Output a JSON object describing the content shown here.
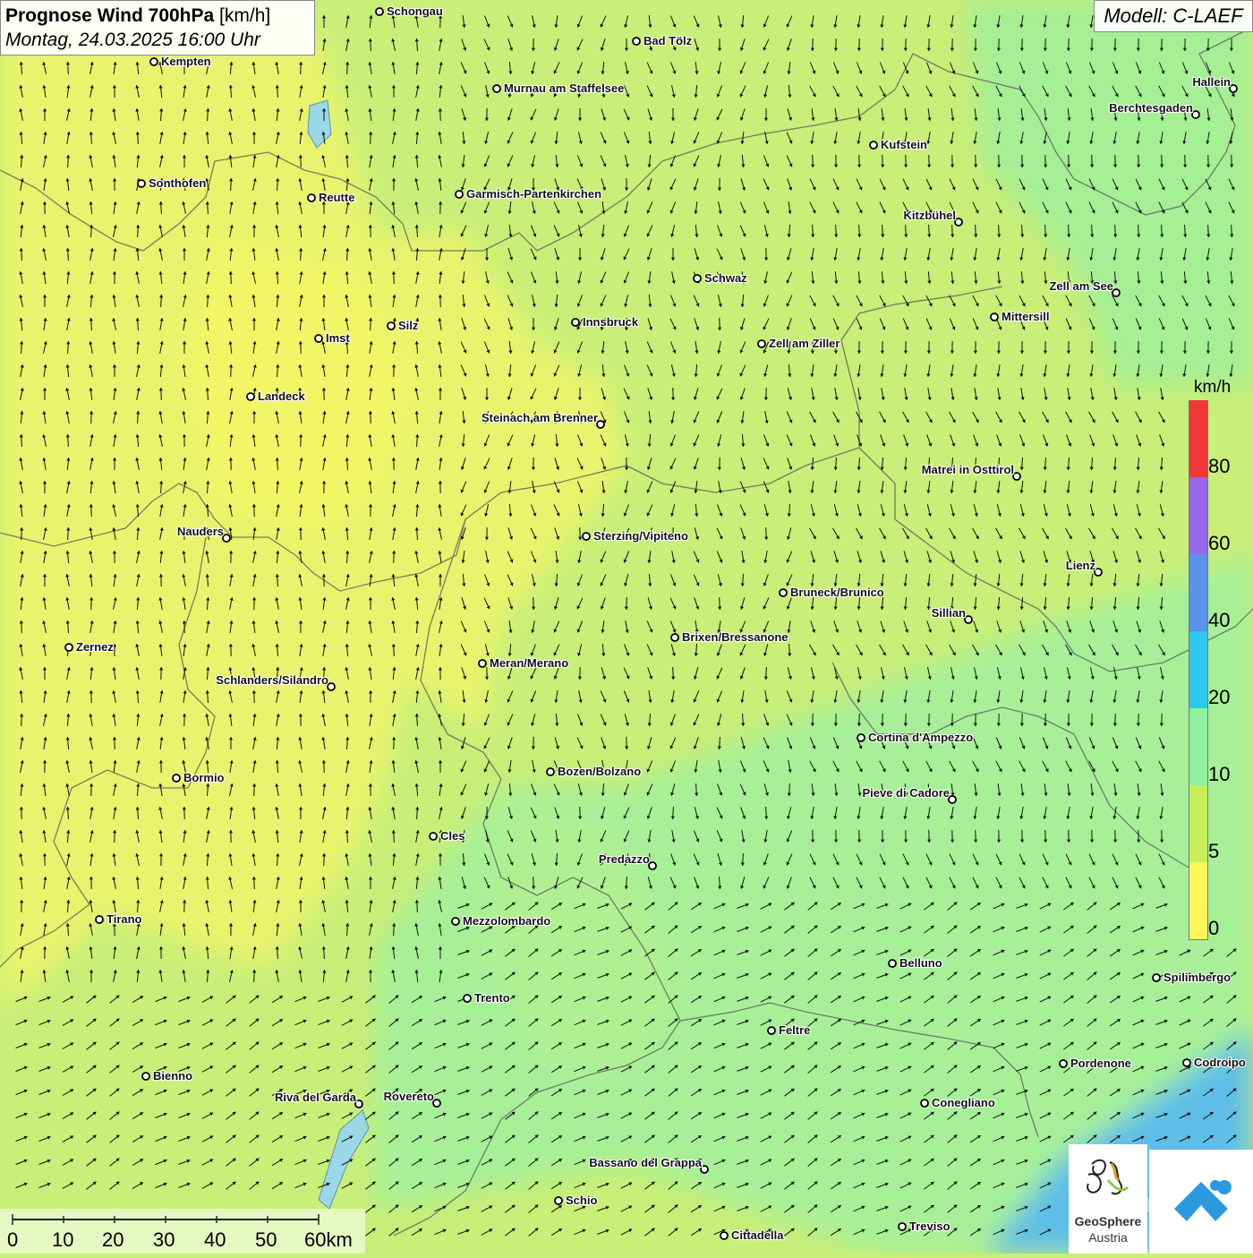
{
  "header": {
    "title_bold": "Prognose Wind 700hPa",
    "title_unit": "[km/h]",
    "datetime": "Montag, 24.03.2025 16:00 Uhr",
    "model": "Modell: C-LAEF"
  },
  "legend": {
    "unit": "km/h",
    "classes": [
      {
        "label": "0",
        "color": "#fff65a"
      },
      {
        "label": "5",
        "color": "#c8ef5a"
      },
      {
        "label": "10",
        "color": "#8ff0a0"
      },
      {
        "label": "20",
        "color": "#2fc6f0"
      },
      {
        "label": "40",
        "color": "#5a92ea"
      },
      {
        "label": "60",
        "color": "#9966ee"
      },
      {
        "label": "80",
        "color": "#f23838"
      }
    ]
  },
  "scale_bar": {
    "labels": [
      "0",
      "10",
      "20",
      "30",
      "40",
      "50",
      "60km"
    ]
  },
  "logo": {
    "name_line1": "GeoSphere",
    "name_line2": "Austria"
  },
  "cities": [
    {
      "name": "Schongau"
    },
    {
      "name": "Bad Tölz"
    },
    {
      "name": "Kempten"
    },
    {
      "name": "Murnau am Staffelsee"
    },
    {
      "name": "Hallein"
    },
    {
      "name": "Berchtesgaden"
    },
    {
      "name": "Kufstein"
    },
    {
      "name": "Sonthofen"
    },
    {
      "name": "Reutte"
    },
    {
      "name": "Garmisch-Partenkirchen"
    },
    {
      "name": "Kitzbühel"
    },
    {
      "name": "Schwaz"
    },
    {
      "name": "Zell am See"
    },
    {
      "name": "Mittersill"
    },
    {
      "name": "Innsbruck"
    },
    {
      "name": "Silz"
    },
    {
      "name": "Imst"
    },
    {
      "name": "Zell am Ziller"
    },
    {
      "name": "Landeck"
    },
    {
      "name": "Steinach am Brenner"
    },
    {
      "name": "Matrei in Osttirol"
    },
    {
      "name": "Nauders"
    },
    {
      "name": "Sterzing/Vipiteno"
    },
    {
      "name": "Lienz"
    },
    {
      "name": "Bruneck/Brunico"
    },
    {
      "name": "Sillian"
    },
    {
      "name": "Brixen/Bressanone"
    },
    {
      "name": "Zernez"
    },
    {
      "name": "Meran/Merano"
    },
    {
      "name": "Schlanders/Silandro"
    },
    {
      "name": "Cortina d'Ampezzo"
    },
    {
      "name": "Bozen/Bolzano"
    },
    {
      "name": "Bormio"
    },
    {
      "name": "Pieve di Cadore"
    },
    {
      "name": "Cles"
    },
    {
      "name": "Predazzo"
    },
    {
      "name": "Tirano"
    },
    {
      "name": "Mezzolombardo"
    },
    {
      "name": "Belluno"
    },
    {
      "name": "Spilimbergo"
    },
    {
      "name": "Trento"
    },
    {
      "name": "Feltre"
    },
    {
      "name": "Pordenone"
    },
    {
      "name": "Codroipo"
    },
    {
      "name": "Bienno"
    },
    {
      "name": "Riva del Garda"
    },
    {
      "name": "Rovereto"
    },
    {
      "name": "Conegliano"
    },
    {
      "name": "Bassano del Grappa"
    },
    {
      "name": "Schio"
    },
    {
      "name": "Treviso"
    },
    {
      "name": "Cittadella"
    }
  ]
}
